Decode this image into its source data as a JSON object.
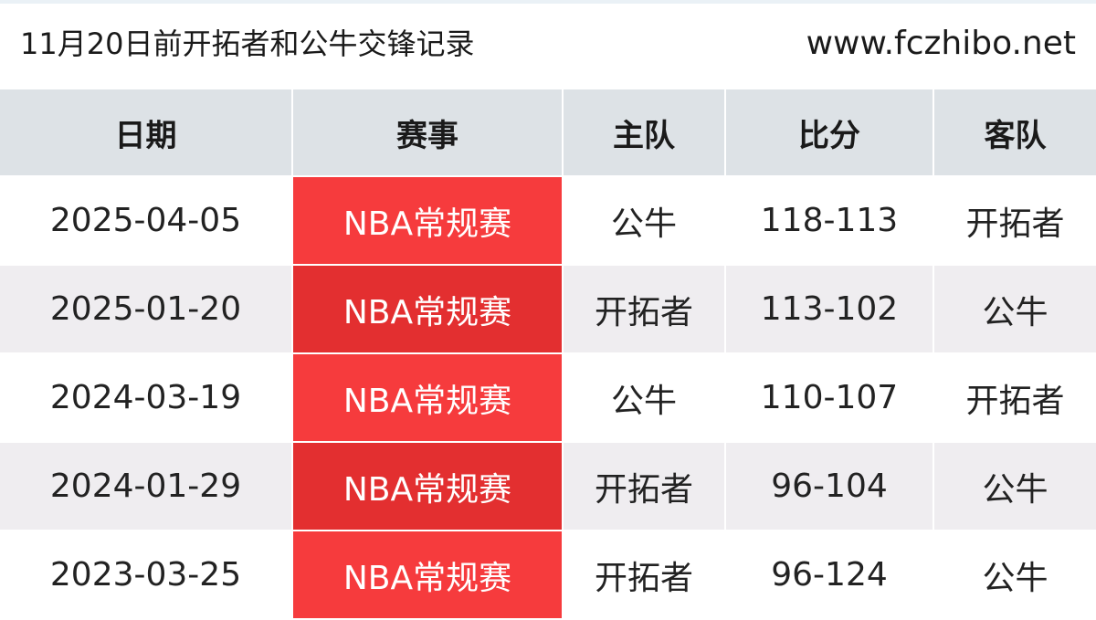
{
  "header": {
    "title": "11月20日前开拓者和公牛交锋记录",
    "site": "www.fczhibo.net"
  },
  "table": {
    "columns": [
      "日期",
      "赛事",
      "主队",
      "比分",
      "客队"
    ],
    "rows": [
      {
        "date": "2025-04-05",
        "event": "NBA常规赛",
        "home": "公牛",
        "score": "118-113",
        "away": "开拓者"
      },
      {
        "date": "2025-01-20",
        "event": "NBA常规赛",
        "home": "开拓者",
        "score": "113-102",
        "away": "公牛"
      },
      {
        "date": "2024-03-19",
        "event": "NBA常规赛",
        "home": "公牛",
        "score": "110-107",
        "away": "开拓者"
      },
      {
        "date": "2024-01-29",
        "event": "NBA常规赛",
        "home": "开拓者",
        "score": "96-104",
        "away": "公牛"
      },
      {
        "date": "2023-03-25",
        "event": "NBA常规赛",
        "home": "开拓者",
        "score": "96-124",
        "away": "公牛"
      }
    ]
  },
  "colors": {
    "header_bg": "#dde2e6",
    "event_bg": "#f63b3d",
    "event_bg_alt": "#e32f30",
    "row_alt_bg": "#efedf0"
  }
}
